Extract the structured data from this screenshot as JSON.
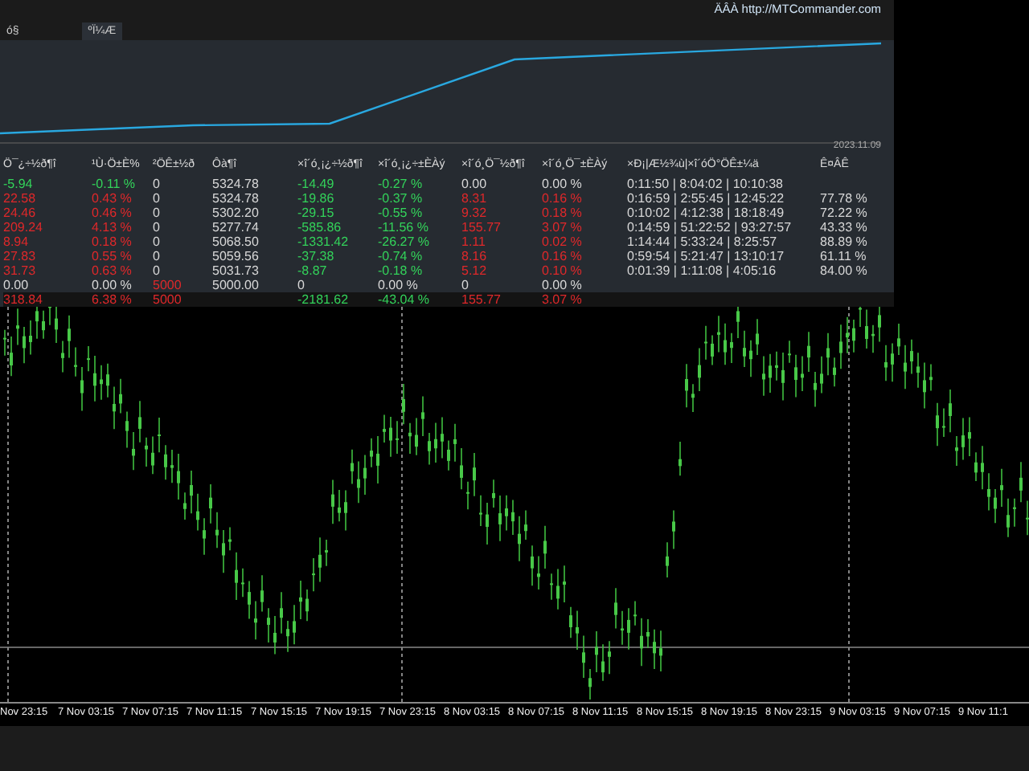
{
  "header": {
    "tabs": [
      {
        "label": "ó§",
        "selected": false
      },
      {
        "label": "ºÏ¼Æ",
        "selected": true
      }
    ],
    "link": "ÄÂÀ http://MTCommander.com"
  },
  "equity_panel": {
    "date": "2023.11.09"
  },
  "table": {
    "columns": [
      "Ö¯¿÷½ð¶î",
      "¹Ù·Ö±È%",
      "²ÖÊ±½ð",
      "Ôà¶î",
      "×î´ó¸¡¿÷½ð¶î",
      "×î´ó¸¡¿÷±ÈÀý",
      "×î´ó¸Ö¯½ð¶î",
      "×î´ó¸Ö¯±ÈÀý",
      "×Ð¡|Æ½¾ù|×î´óÖ°ÖÊ±¼ä",
      "Ê¤ÂÊ"
    ],
    "rows": [
      {
        "total": false,
        "cells": [
          {
            "text": "-5.94",
            "color": "#33d35a"
          },
          {
            "text": "-0.11 %",
            "color": "#33d35a"
          },
          {
            "text": "0",
            "color": "#d8d8d8"
          },
          {
            "text": "5324.78",
            "color": "#d8d8d8"
          },
          {
            "text": "-14.49",
            "color": "#33d35a"
          },
          {
            "text": "-0.27 %",
            "color": "#33d35a"
          },
          {
            "text": "0.00",
            "color": "#d8d8d8"
          },
          {
            "text": "0.00 %",
            "color": "#d8d8d8"
          },
          {
            "text": "0:11:50 | 8:04:02 | 10:10:38",
            "color": "#d8d8d8"
          }
        ]
      },
      {
        "total": false,
        "cells": [
          {
            "text": "22.58",
            "color": "#e0282a"
          },
          {
            "text": "0.43 %",
            "color": "#e0282a"
          },
          {
            "text": "0",
            "color": "#d8d8d8"
          },
          {
            "text": "5324.78",
            "color": "#d8d8d8"
          },
          {
            "text": "-19.86",
            "color": "#33d35a"
          },
          {
            "text": "-0.37 %",
            "color": "#33d35a"
          },
          {
            "text": "8.31",
            "color": "#e0282a"
          },
          {
            "text": "0.16 %",
            "color": "#e0282a"
          },
          {
            "text": "0:16:59 | 2:55:45 | 12:45:22",
            "color": "#d8d8d8"
          },
          {
            "text": "77.78 %",
            "color": "#d8d8d8"
          }
        ]
      },
      {
        "total": false,
        "cells": [
          {
            "text": "24.46",
            "color": "#e0282a"
          },
          {
            "text": "0.46 %",
            "color": "#e0282a"
          },
          {
            "text": "0",
            "color": "#d8d8d8"
          },
          {
            "text": "5302.20",
            "color": "#d8d8d8"
          },
          {
            "text": "-29.15",
            "color": "#33d35a"
          },
          {
            "text": "-0.55 %",
            "color": "#33d35a"
          },
          {
            "text": "9.32",
            "color": "#e0282a"
          },
          {
            "text": "0.18 %",
            "color": "#e0282a"
          },
          {
            "text": "0:10:02 | 4:12:38 | 18:18:49",
            "color": "#d8d8d8"
          },
          {
            "text": "72.22 %",
            "color": "#d8d8d8"
          }
        ]
      },
      {
        "total": false,
        "cells": [
          {
            "text": "209.24",
            "color": "#e0282a"
          },
          {
            "text": "4.13 %",
            "color": "#e0282a"
          },
          {
            "text": "0",
            "color": "#d8d8d8"
          },
          {
            "text": "5277.74",
            "color": "#d8d8d8"
          },
          {
            "text": "-585.86",
            "color": "#33d35a"
          },
          {
            "text": "-11.56 %",
            "color": "#33d35a"
          },
          {
            "text": "155.77",
            "color": "#e0282a"
          },
          {
            "text": "3.07 %",
            "color": "#e0282a"
          },
          {
            "text": "0:14:59 | 51:22:52 | 93:27:57",
            "color": "#d8d8d8"
          },
          {
            "text": "43.33 %",
            "color": "#d8d8d8"
          }
        ]
      },
      {
        "total": false,
        "cells": [
          {
            "text": "8.94",
            "color": "#e0282a"
          },
          {
            "text": "0.18 %",
            "color": "#e0282a"
          },
          {
            "text": "0",
            "color": "#d8d8d8"
          },
          {
            "text": "5068.50",
            "color": "#d8d8d8"
          },
          {
            "text": "-1331.42",
            "color": "#33d35a"
          },
          {
            "text": "-26.27 %",
            "color": "#33d35a"
          },
          {
            "text": "1.11",
            "color": "#e0282a"
          },
          {
            "text": "0.02 %",
            "color": "#e0282a"
          },
          {
            "text": "1:14:44 | 5:33:24 | 8:25:57",
            "color": "#d8d8d8"
          },
          {
            "text": "88.89 %",
            "color": "#d8d8d8"
          }
        ]
      },
      {
        "total": false,
        "cells": [
          {
            "text": "27.83",
            "color": "#e0282a"
          },
          {
            "text": "0.55 %",
            "color": "#e0282a"
          },
          {
            "text": "0",
            "color": "#d8d8d8"
          },
          {
            "text": "5059.56",
            "color": "#d8d8d8"
          },
          {
            "text": "-37.38",
            "color": "#33d35a"
          },
          {
            "text": "-0.74 %",
            "color": "#33d35a"
          },
          {
            "text": "8.16",
            "color": "#e0282a"
          },
          {
            "text": "0.16 %",
            "color": "#e0282a"
          },
          {
            "text": "0:59:54 | 5:21:47 | 13:10:17",
            "color": "#d8d8d8"
          },
          {
            "text": "61.11 %",
            "color": "#d8d8d8"
          }
        ]
      },
      {
        "total": false,
        "cells": [
          {
            "text": "31.73",
            "color": "#e0282a"
          },
          {
            "text": "0.63 %",
            "color": "#e0282a"
          },
          {
            "text": "0",
            "color": "#d8d8d8"
          },
          {
            "text": "5031.73",
            "color": "#d8d8d8"
          },
          {
            "text": "-8.87",
            "color": "#33d35a"
          },
          {
            "text": "-0.18 %",
            "color": "#33d35a"
          },
          {
            "text": "5.12",
            "color": "#e0282a"
          },
          {
            "text": "0.10 %",
            "color": "#e0282a"
          },
          {
            "text": "0:01:39 | 1:11:08 | 4:05:16",
            "color": "#d8d8d8"
          },
          {
            "text": "84.00 %",
            "color": "#d8d8d8"
          }
        ]
      },
      {
        "total": false,
        "cells": [
          {
            "text": "0.00",
            "color": "#d8d8d8"
          },
          {
            "text": "0.00 %",
            "color": "#d8d8d8"
          },
          {
            "text": "5000",
            "color": "#e0282a"
          },
          {
            "text": "5000.00",
            "color": "#d8d8d8"
          },
          {
            "text": "0",
            "color": "#d8d8d8"
          },
          {
            "text": "0.00 %",
            "color": "#d8d8d8"
          },
          {
            "text": "0",
            "color": "#d8d8d8"
          },
          {
            "text": "0.00 %",
            "color": "#d8d8d8"
          }
        ]
      },
      {
        "total": true,
        "cells": [
          {
            "text": "318.84",
            "color": "#e0282a"
          },
          {
            "text": "6.38 %",
            "color": "#e0282a"
          },
          {
            "text": "5000",
            "color": "#e0282a"
          },
          null,
          {
            "text": "-2181.62",
            "color": "#33d35a"
          },
          {
            "text": "-43.04 %",
            "color": "#33d35a"
          },
          {
            "text": "155.77",
            "color": "#e0282a"
          },
          {
            "text": "3.07 %",
            "color": "#e0282a"
          }
        ]
      }
    ]
  },
  "time_axis": [
    "Nov 23:15",
    "7 Nov 03:15",
    "7 Nov 07:15",
    "7 Nov 11:15",
    "7 Nov 15:15",
    "7 Nov 19:15",
    "7 Nov 23:15",
    "8 Nov 03:15",
    "8 Nov 07:15",
    "8 Nov 11:15",
    "8 Nov 15:15",
    "8 Nov 19:15",
    "8 Nov 23:15",
    "9 Nov 03:15",
    "9 Nov 07:15",
    "9 Nov 11:1"
  ]
}
